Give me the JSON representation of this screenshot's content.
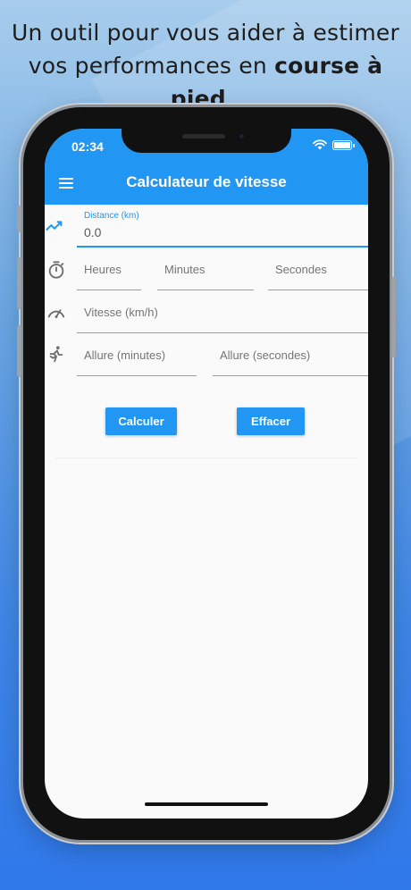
{
  "promo": {
    "line1": "Un outil pour vous aider à estimer",
    "line2_prefix": "vos performances en ",
    "line2_bold": "course à pied",
    "line2_suffix": " ."
  },
  "status_bar": {
    "time": "02:34",
    "battery_level": 1.0
  },
  "app": {
    "title": "Calculateur de vitesse"
  },
  "form": {
    "distance": {
      "label": "Distance (km)",
      "value": "0.0"
    },
    "hours": {
      "placeholder": "Heures"
    },
    "minutes": {
      "placeholder": "Minutes"
    },
    "seconds": {
      "placeholder": "Secondes"
    },
    "speed": {
      "placeholder": "Vitesse (km/h)"
    },
    "pace_minutes": {
      "placeholder": "Allure (minutes)"
    },
    "pace_seconds": {
      "placeholder": "Allure (secondes)"
    }
  },
  "buttons": {
    "calculate": "Calculer",
    "clear": "Effacer"
  },
  "colors": {
    "primary": "#2196f3",
    "text": "#1d1d1d"
  },
  "icons": {
    "distance": "trending-up-icon",
    "time": "timer-icon",
    "speed": "speedometer-icon",
    "pace": "runner-icon"
  }
}
